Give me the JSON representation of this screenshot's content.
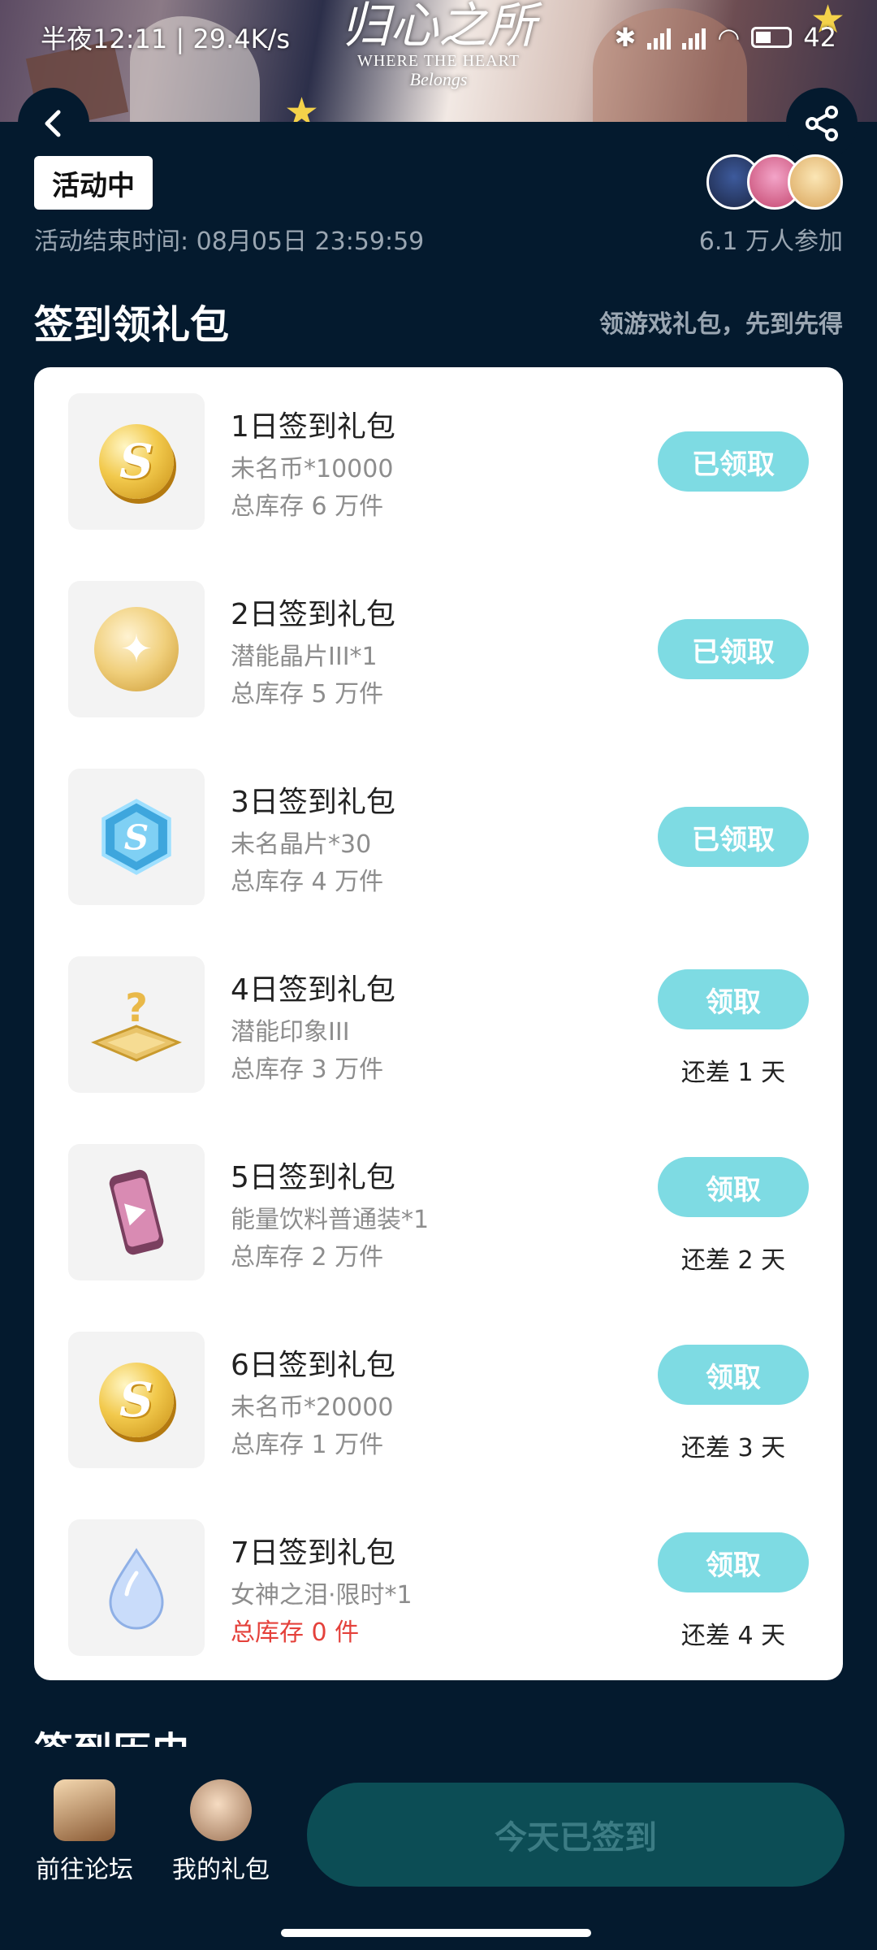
{
  "status_bar": {
    "time": "半夜12:11",
    "net_speed": "29.4K/s",
    "battery": "42"
  },
  "banner": {
    "logo_cn": "归心之所",
    "logo_en": "WHERE THE HEART",
    "logo_sub": "Belongs"
  },
  "header": {
    "back_icon": "back-arrow-icon",
    "share_icon": "share-icon"
  },
  "activity": {
    "status": "活动中",
    "end_time": "活动结束时间: 08月05日 23:59:59",
    "participants": "6.1 万人参加"
  },
  "checkin_section": {
    "title": "签到领礼包",
    "subtitle": "领游戏礼包，先到先得"
  },
  "gifts": [
    {
      "name": "1日签到礼包",
      "item": "未名币*10000",
      "stock": "总库存 6 万件",
      "button": "已领取",
      "days_left": "",
      "icon": "coin-icon"
    },
    {
      "name": "2日签到礼包",
      "item": "潜能晶片III*1",
      "stock": "总库存 5 万件",
      "button": "已领取",
      "days_left": "",
      "icon": "potential-chip-icon"
    },
    {
      "name": "3日签到礼包",
      "item": "未名晶片*30",
      "stock": "总库存 4 万件",
      "button": "已领取",
      "days_left": "",
      "icon": "crystal-hexagon-icon"
    },
    {
      "name": "4日签到礼包",
      "item": "潜能印象III",
      "stock": "总库存 3 万件",
      "button": "领取",
      "days_left": "还差 1 天",
      "icon": "mystery-plate-icon"
    },
    {
      "name": "5日签到礼包",
      "item": "能量饮料普通装*1",
      "stock": "总库存 2 万件",
      "button": "领取",
      "days_left": "还差 2 天",
      "icon": "energy-drink-icon"
    },
    {
      "name": "6日签到礼包",
      "item": "未名币*20000",
      "stock": "总库存 1 万件",
      "button": "领取",
      "days_left": "还差 3 天",
      "icon": "coin-icon"
    },
    {
      "name": "7日签到礼包",
      "item": "女神之泪·限时*1",
      "stock": "总库存 0 件",
      "button": "领取",
      "days_left": "还差 4 天",
      "icon": "tear-drop-icon"
    }
  ],
  "history_section": {
    "title": "签到历史"
  },
  "bottom_bar": {
    "forum_label": "前往论坛",
    "gifts_label": "我的礼包",
    "checkin_label": "今天已签到"
  },
  "colors": {
    "background": "#041a2e",
    "button": "#7edbe3",
    "checkin_disabled": "#0c4d55",
    "stock_empty": "#e4413b"
  }
}
